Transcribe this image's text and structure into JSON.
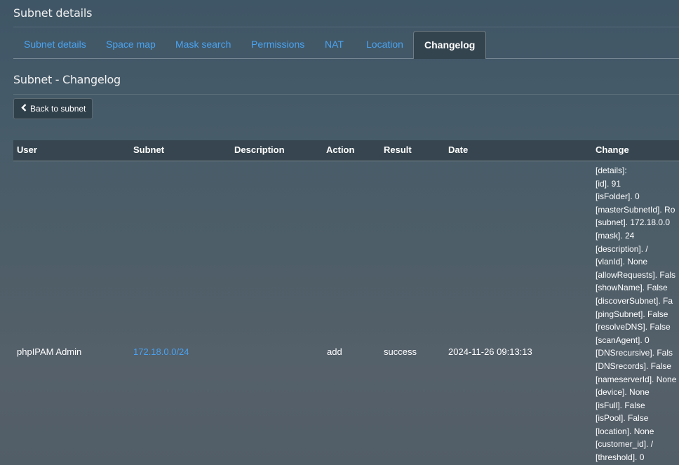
{
  "header": {
    "title": "Subnet details"
  },
  "tabs": [
    {
      "label": "Subnet details",
      "active": false
    },
    {
      "label": "Space map",
      "active": false
    },
    {
      "label": "Mask search",
      "active": false
    },
    {
      "label": "Permissions",
      "active": false
    },
    {
      "label": "NAT",
      "active": false
    },
    {
      "label": "Location",
      "active": false
    },
    {
      "label": "Changelog",
      "active": true
    }
  ],
  "section": {
    "title": "Subnet - Changelog"
  },
  "back_button": {
    "label": "Back to subnet",
    "icon": "chevron-left-icon"
  },
  "table": {
    "columns": [
      "User",
      "Subnet",
      "Description",
      "Action",
      "Result",
      "Date",
      "Change"
    ],
    "rows": [
      {
        "user": "phpIPAM Admin",
        "subnet": "172.18.0.0/24",
        "description": "",
        "action": "add",
        "result": "success",
        "date": "2024-11-26 09:13:13",
        "change": [
          "[details]:",
          "[id]. 91",
          "[isFolder]. 0",
          "[masterSubnetId]. Ro",
          "[subnet]. 172.18.0.0",
          "[mask]. 24",
          "[description]. /",
          "[vlanId]. None",
          "[allowRequests]. Fals",
          "[showName]. False",
          "[discoverSubnet]. Fa",
          "[pingSubnet]. False",
          "[resolveDNS]. False",
          "[scanAgent]. 0",
          "[DNSrecursive]. Fals",
          "[DNSrecords]. False",
          "[nameserverId]. None",
          "[device]. None",
          "[isFull]. False",
          "[isPool]. False",
          "[location]. None",
          "[customer_id]. /",
          "[threshold]. 0"
        ]
      }
    ]
  },
  "colors": {
    "link": "#4aa3f0",
    "text": "#ffffff",
    "header_bg": "#36454f"
  }
}
